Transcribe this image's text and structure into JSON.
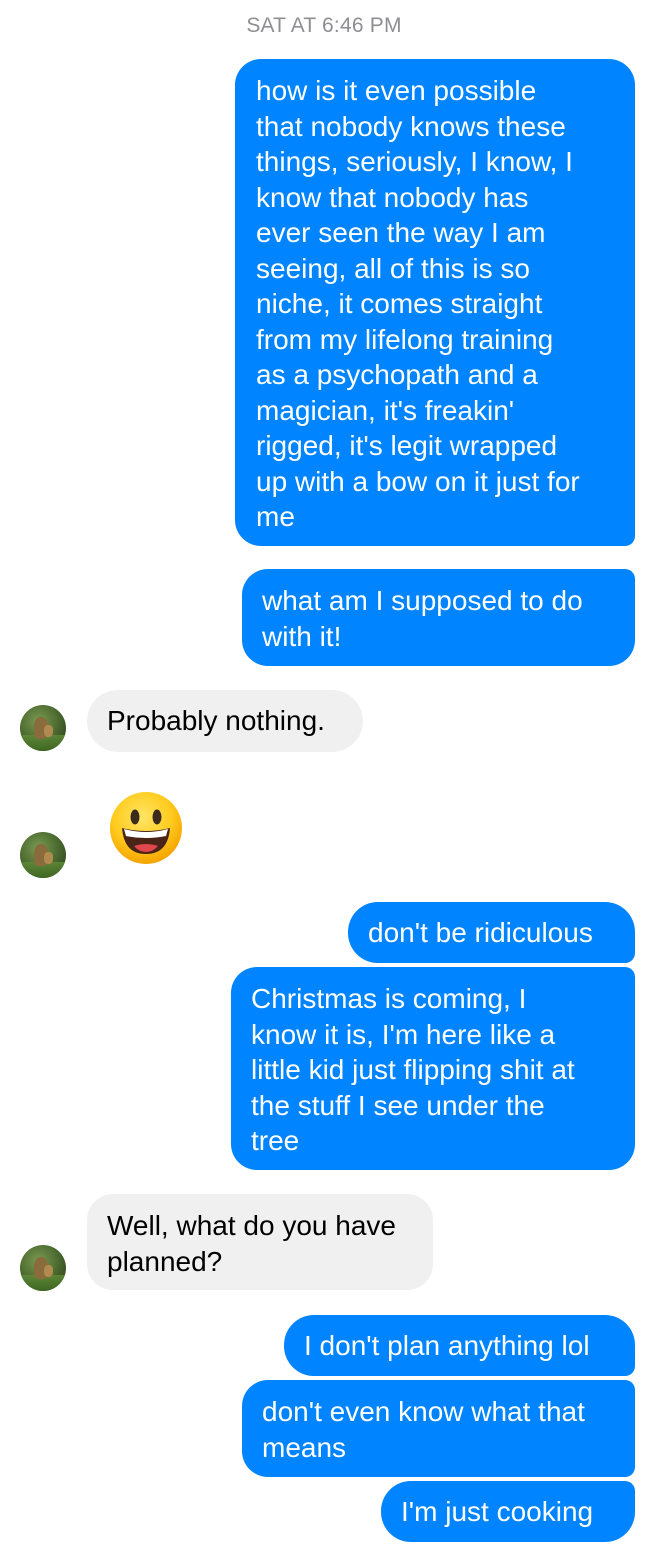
{
  "conversation": {
    "timestamp": "SAT AT 6:46 PM",
    "messages": [
      {
        "sender": "me",
        "text": "how is it even possible\nthat nobody knows these\nthings, seriously, I know, I\nknow that nobody has\never seen the way I am\nseeing, all of this is so\nniche, it comes straight\nfrom my lifelong training\nas a psychopath and a\nmagician, it's freakin'\nrigged, it's legit wrapped\nup with a bow on it just for\nme"
      },
      {
        "sender": "me",
        "text": "what am I supposed to do\nwith it!"
      },
      {
        "sender": "them",
        "text": "Probably nothing."
      },
      {
        "sender": "them",
        "emoji": "grinning-face"
      },
      {
        "sender": "me",
        "text": "don't be ridiculous"
      },
      {
        "sender": "me",
        "text": "Christmas is coming, I\nknow it is, I'm here like a\nlittle kid just flipping shit at\nthe stuff I see under the\ntree"
      },
      {
        "sender": "them",
        "text": "Well, what do you have\nplanned?"
      },
      {
        "sender": "me",
        "text": "I don't plan anything lol"
      },
      {
        "sender": "me",
        "text": "don't even know what that\nmeans"
      },
      {
        "sender": "me",
        "text": "I'm just cooking"
      }
    ]
  },
  "colors": {
    "outgoing_bubble": "#0084ff",
    "incoming_bubble": "#f1f0f0",
    "timestamp_text": "#8e8e93"
  }
}
